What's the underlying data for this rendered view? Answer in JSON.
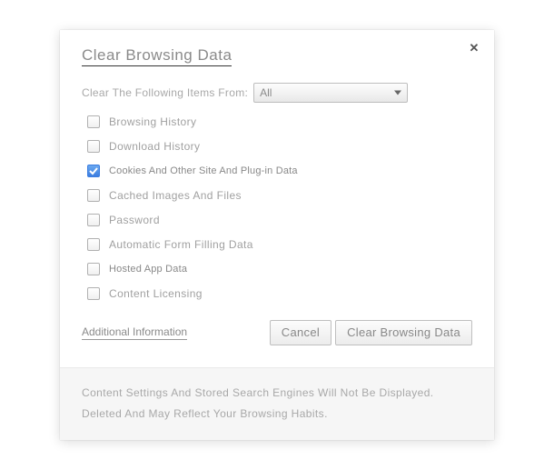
{
  "dialog": {
    "title": "Clear Browsing Data",
    "close_glyph": "✕",
    "time_label": "Clear The Following Items From:",
    "time_selected": "All",
    "options": [
      {
        "label": "Browsing History",
        "checked": false,
        "small": false
      },
      {
        "label": "Download History",
        "checked": false,
        "small": false
      },
      {
        "label": "Cookies And Other Site And Plug-in Data",
        "checked": true,
        "small": true
      },
      {
        "label": "Cached Images And Files",
        "checked": false,
        "small": false
      },
      {
        "label": "Password",
        "checked": false,
        "small": false
      },
      {
        "label": "Automatic Form Filling Data",
        "checked": false,
        "small": false
      },
      {
        "label": "Hosted App Data",
        "checked": false,
        "small": true
      },
      {
        "label": "Content Licensing",
        "checked": false,
        "small": false
      }
    ],
    "more_info": "Additional Information",
    "cancel": "Cancel",
    "confirm": "Clear Browsing Data",
    "footer_line1": "Content Settings And Stored Search Engines Will Not Be Displayed.",
    "footer_line2": "Deleted And May Reflect Your Browsing Habits."
  }
}
